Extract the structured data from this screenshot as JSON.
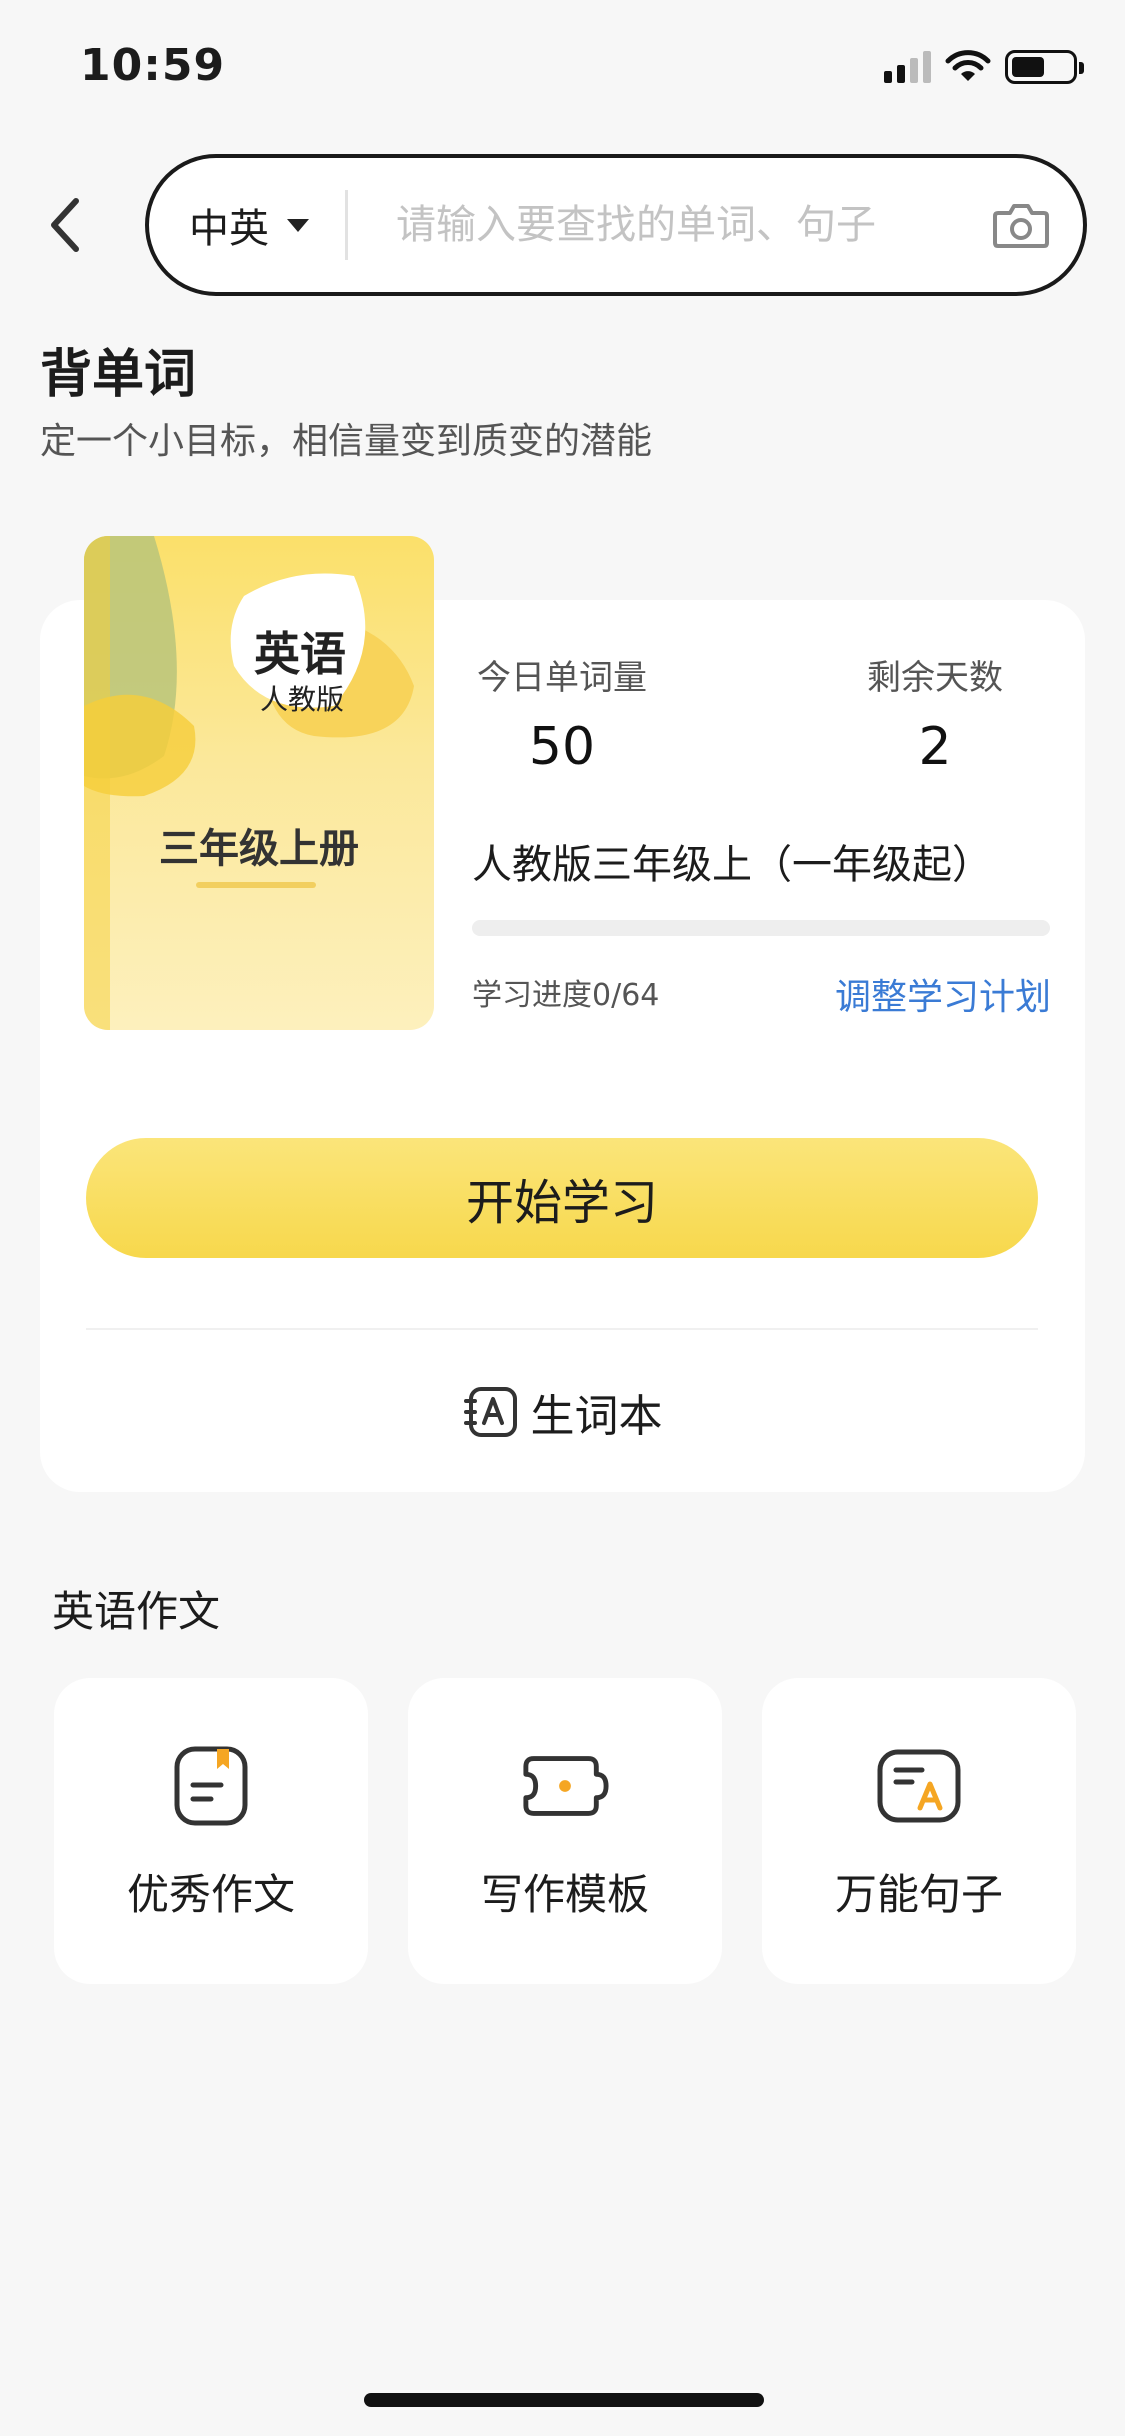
{
  "status_bar": {
    "time": "10:59"
  },
  "search": {
    "language": "中英",
    "placeholder": "请输入要查找的单词、句子"
  },
  "header": {
    "title": "背单词",
    "subtitle": "定一个小目标，相信量变到质变的潜能"
  },
  "book": {
    "cover_subject": "英语",
    "cover_edition": "人教版",
    "cover_grade": "三年级上册",
    "name": "人教版三年级上（一年级起）"
  },
  "stats": {
    "daily_words_label": "今日单词量",
    "daily_words_value": "50",
    "remaining_days_label": "剩余天数",
    "remaining_days_value": "2"
  },
  "progress": {
    "text": "学习进度0/64",
    "fraction": 0
  },
  "actions": {
    "adjust_plan": "调整学习计划",
    "start": "开始学习",
    "vocab_book": "生词本"
  },
  "essay": {
    "section_title": "英语作文",
    "tiles": [
      {
        "label": "优秀作文",
        "icon": "document-bookmark-icon"
      },
      {
        "label": "写作模板",
        "icon": "template-puzzle-icon"
      },
      {
        "label": "万能句子",
        "icon": "sentence-a-icon"
      }
    ]
  },
  "colors": {
    "accent_yellow": "#f7d84c",
    "link_blue": "#3a7bd5",
    "icon_orange": "#f5a623"
  }
}
